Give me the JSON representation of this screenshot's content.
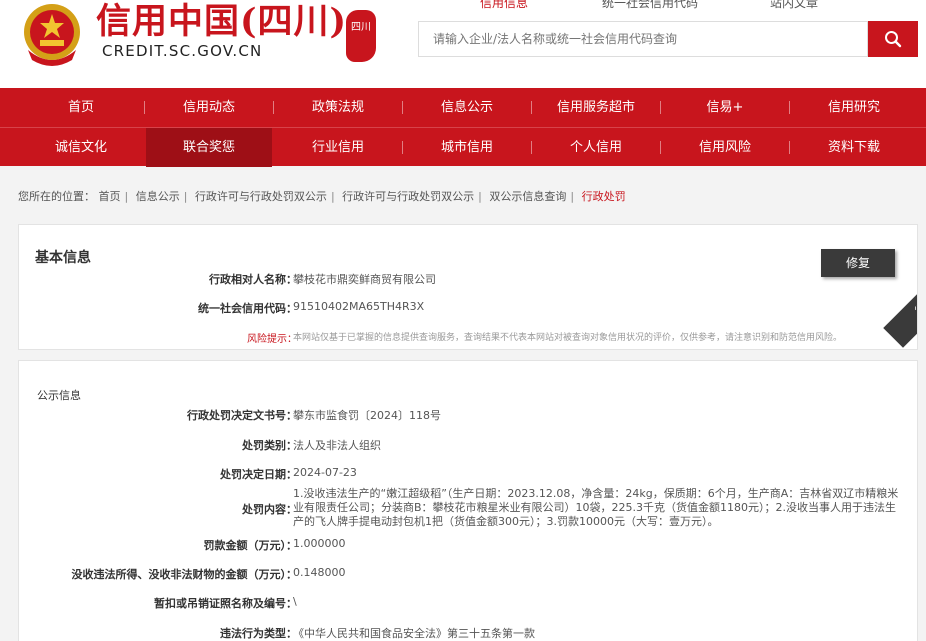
{
  "header": {
    "title": "信用中国(四川)",
    "url": "CREDIT.SC.GOV.CN",
    "seal_text": "四川",
    "top_links": [
      "信用信息",
      "统一社会信用代码",
      "站内文章"
    ],
    "search_placeholder": "请输入企业/法人名称或统一社会信用代码查询"
  },
  "nav": {
    "row1": [
      "首页",
      "信用动态",
      "政策法规",
      "信息公示",
      "信用服务超市",
      "信易+",
      "信用研究"
    ],
    "row2": [
      "诚信文化",
      "联合奖惩",
      "行业信用",
      "城市信用",
      "个人信用",
      "信用风险",
      "资料下载"
    ],
    "selected": "联合奖惩"
  },
  "breadcrumb": {
    "prefix": "您所在的位置：",
    "items": [
      "首页",
      "信息公示",
      "行政许可与行政处罚双公示",
      "行政许可与行政处罚双公示",
      "双公示信息查询"
    ],
    "current": "行政处罚"
  },
  "basic": {
    "title": "基本信息",
    "repair_label": "修复",
    "corner_label": "行政处罚",
    "subject_label": "行政相对人名称：",
    "subject_value": "攀枝花市鼎奕鲜商贸有限公司",
    "code_label": "统一社会信用代码：",
    "code_value": "91510402MA65TH4R3X",
    "warn_label": "风险提示：",
    "warn_value": "本网站仅基于已掌握的信息提供查询服务，查询结果不代表本网站对被查询对象信用状况的评价，仅供参考，请注意识别和防范信用风险。"
  },
  "publicity": {
    "title": "公示信息",
    "rows": [
      {
        "label": "行政处罚决定文书号：",
        "value": "攀东市监食罚〔2024〕118号"
      },
      {
        "label": "处罚类别：",
        "value": "法人及非法人组织"
      },
      {
        "label": "处罚决定日期：",
        "value": "2024-07-23"
      },
      {
        "label": "处罚内容：",
        "value": "1.没收违法生产的“嫩江超级稻”（生产日期：2023.12.08，净含量：24kg，保质期：6个月，生产商A：吉林省双辽市精粮米业有限责任公司；分装商B：攀枝花市粮星米业有限公司）10袋，225.3千克（货值金额1180元）；2.没收当事人用于违法生产的飞人牌手提电动封包机1把（货值金额300元）；3.罚款10000元（大写：壹万元）。"
      },
      {
        "label": "罚款金额（万元）：",
        "value": "1.000000"
      },
      {
        "label": "没收违法所得、没收非法财物的金额（万元）：",
        "value": "0.148000"
      },
      {
        "label": "暂扣或吊销证照名称及编号：",
        "value": "\\"
      },
      {
        "label": "违法行为类型：",
        "value": "《中华人民共和国食品安全法》第三十五条第一款"
      }
    ]
  },
  "colors": {
    "brand_red": "#c8151d",
    "nav_selected": "#9e0f16",
    "dark_button": "#3a3a3a"
  }
}
